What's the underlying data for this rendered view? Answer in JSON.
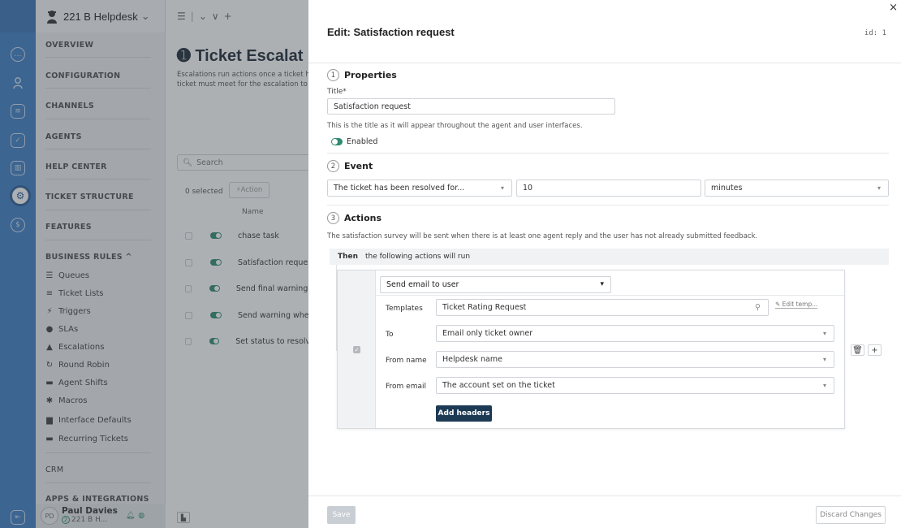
{
  "app": {
    "workspace": "221 B Helpdesk",
    "chevron": "⌄"
  },
  "nav": {
    "sections": [
      "OVERVIEW",
      "CONFIGURATION",
      "CHANNELS",
      "AGENTS",
      "HELP CENTER",
      "TICKET STRUCTURE",
      "FEATURES",
      "BUSINESS RULES ^",
      "CRM",
      "APPS & INTEGRATIONS"
    ],
    "business_rules": [
      "Queues",
      "Ticket Lists",
      "Triggers",
      "SLAs",
      "Escalations",
      "Round Robin",
      "Agent Shifts",
      "Macros",
      "Interface Defaults",
      "Recurring Tickets"
    ],
    "user": {
      "initials": "PD",
      "name": "Paul Davies",
      "workspace": "221 B H...",
      "count": "2"
    }
  },
  "list_page": {
    "title": "Ticket Escalat",
    "desc_line1": "Escalations run actions once a ticket ha",
    "desc_line2": "ticket must meet for the escalation to r",
    "search": "Search",
    "selected": "0 selected",
    "action": "Action",
    "name_header": "Name",
    "rows": [
      "chase task",
      "Satisfaction request",
      "Send final warning v",
      "Send warning when",
      "Set status to resolve"
    ]
  },
  "drawer": {
    "title": "Edit: Satisfaction request",
    "id": "id: 1",
    "close": "×",
    "properties": {
      "num": "1",
      "heading": "Properties",
      "title_label": "Title*",
      "title_value": "Satisfaction request",
      "help": "This is the title as it will appear throughout the agent and user interfaces.",
      "enabled": "Enabled"
    },
    "event": {
      "num": "2",
      "heading": "Event",
      "condition": "The ticket has been resolved for...",
      "amount": "10",
      "unit": "minutes"
    },
    "actions": {
      "num": "3",
      "heading": "Actions",
      "help": "The satisfaction survey will be sent when there is at least one agent reply and the user has not already submitted feedback.",
      "then": "Then",
      "then_desc": "the following actions will run",
      "action_type": "Send email to user",
      "templates_label": "Templates",
      "templates_value": "Ticket Rating Request",
      "edit_template": "Edit temp...",
      "to_label": "To",
      "to_value": "Email only ticket owner",
      "from_name_label": "From name",
      "from_name_value": "Helpdesk name",
      "from_email_label": "From email",
      "from_email_value": "The account set on the ticket",
      "add_headers": "Add headers"
    },
    "footer": {
      "save": "Save",
      "discard": "Discard Changes"
    }
  },
  "colors": {
    "rail": "#3f7fc5",
    "accent_green": "#2f8b72",
    "button_dark": "#1d3a55"
  }
}
